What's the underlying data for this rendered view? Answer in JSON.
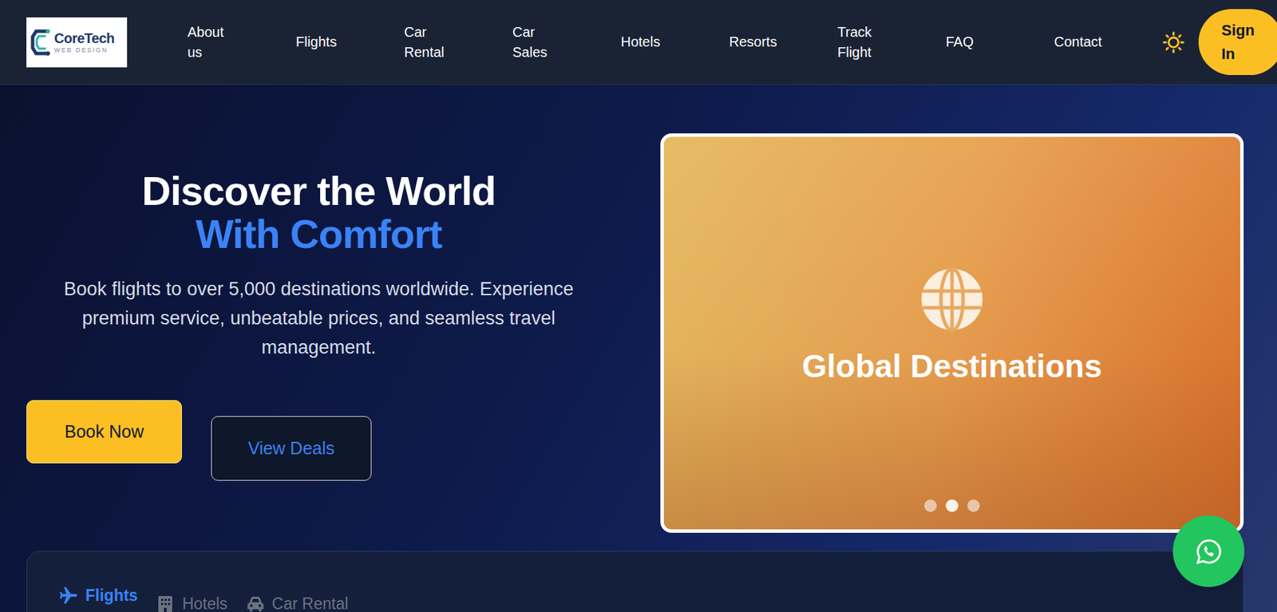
{
  "logo": {
    "name": "CoreTech",
    "tagline": "WEB DESIGN"
  },
  "nav": {
    "items": [
      "About us",
      "Flights",
      "Car Rental",
      "Car Sales",
      "Hotels",
      "Resorts",
      "Track Flight",
      "FAQ",
      "Contact"
    ],
    "sign_in": "Sign In"
  },
  "hero": {
    "title": "Discover the World",
    "highlight": "With Comfort",
    "description": "Book flights to over 5,000 destinations worldwide. Experience premium service, unbeatable prices, and seamless travel management.",
    "buttons": [
      "Book Now",
      "View Deals"
    ]
  },
  "carousel": {
    "caption": "Global Destinations",
    "dots": [
      {
        "selected": false
      },
      {
        "selected": true
      },
      {
        "selected": false
      }
    ]
  },
  "search": {
    "tabs": [
      {
        "label": "Flights",
        "selected": true
      },
      {
        "label": "Hotels",
        "selected": false
      },
      {
        "label": "Car Rental",
        "selected": false
      }
    ]
  }
}
